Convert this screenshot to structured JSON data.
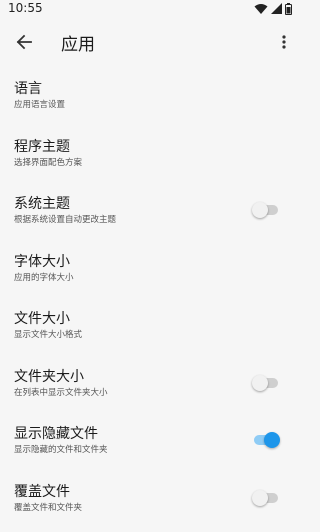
{
  "status_bar": {
    "time": "10:55",
    "icons": [
      "wifi-icon",
      "cellular-signal-icon",
      "battery-icon"
    ]
  },
  "app_bar": {
    "back_icon": "arrow-left-icon",
    "title": "应用",
    "more_icon": "more-vert-icon"
  },
  "colors": {
    "accent": "#1e96ea",
    "background": "#f6f6f6",
    "toggle_off_track": "#cfcfcf"
  },
  "settings": [
    {
      "title": "语言",
      "subtitle": "应用语言设置",
      "has_toggle": false
    },
    {
      "title": "程序主题",
      "subtitle": "选择界面配色方案",
      "has_toggle": false
    },
    {
      "title": "系统主题",
      "subtitle": "根据系统设置自动更改主题",
      "has_toggle": true,
      "toggle_on": false
    },
    {
      "title": "字体大小",
      "subtitle": "应用的字体大小",
      "has_toggle": false
    },
    {
      "title": "文件大小",
      "subtitle": "显示文件大小格式",
      "has_toggle": false
    },
    {
      "title": "文件夹大小",
      "subtitle": "在列表中显示文件夹大小",
      "has_toggle": true,
      "toggle_on": false
    },
    {
      "title": "显示隐藏文件",
      "subtitle": "显示隐藏的文件和文件夹",
      "has_toggle": true,
      "toggle_on": true
    },
    {
      "title": "覆盖文件",
      "subtitle": "覆盖文件和文件夹",
      "has_toggle": true,
      "toggle_on": false
    }
  ]
}
